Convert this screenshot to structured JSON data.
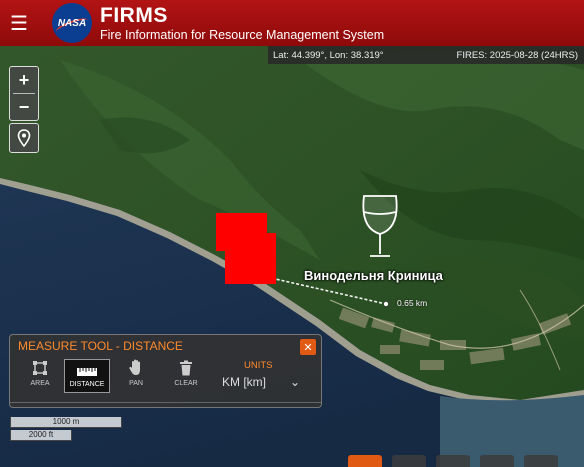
{
  "header": {
    "app_name": "FIRMS",
    "app_subtitle": "Fire Information for Resource Management System",
    "logo_text": "NASA"
  },
  "status": {
    "coordinates": "Lat: 44.399°, Lon: 38.319°",
    "fires": "FIRES: 2025-08-28 (24HRS)"
  },
  "map": {
    "zoom_in": "+",
    "zoom_out": "−",
    "place_label": "Винодельня Криница",
    "distance_label": "0.65 km",
    "fire_color": "#ff0000",
    "icons": [
      "menu-icon",
      "locate-icon",
      "wine-glass-icon"
    ]
  },
  "measure_tool": {
    "title": "MEASURE TOOL - DISTANCE",
    "close_label": "✕",
    "tools": [
      {
        "label": "AREA",
        "icon": "area-icon"
      },
      {
        "label": "DISTANCE",
        "icon": "ruler-icon",
        "active": true
      },
      {
        "label": "PAN",
        "icon": "hand-icon"
      },
      {
        "label": "CLEAR",
        "icon": "trash-icon"
      }
    ],
    "units_heading": "UNITS",
    "units_value": "KM [km]",
    "units_caret": "⌄",
    "accent_color": "#ff8a2a"
  },
  "scale": {
    "metric": "1000 m",
    "imperial": "2000 ft"
  },
  "colors": {
    "header": "#a51010",
    "close_button": "#e05a14"
  }
}
